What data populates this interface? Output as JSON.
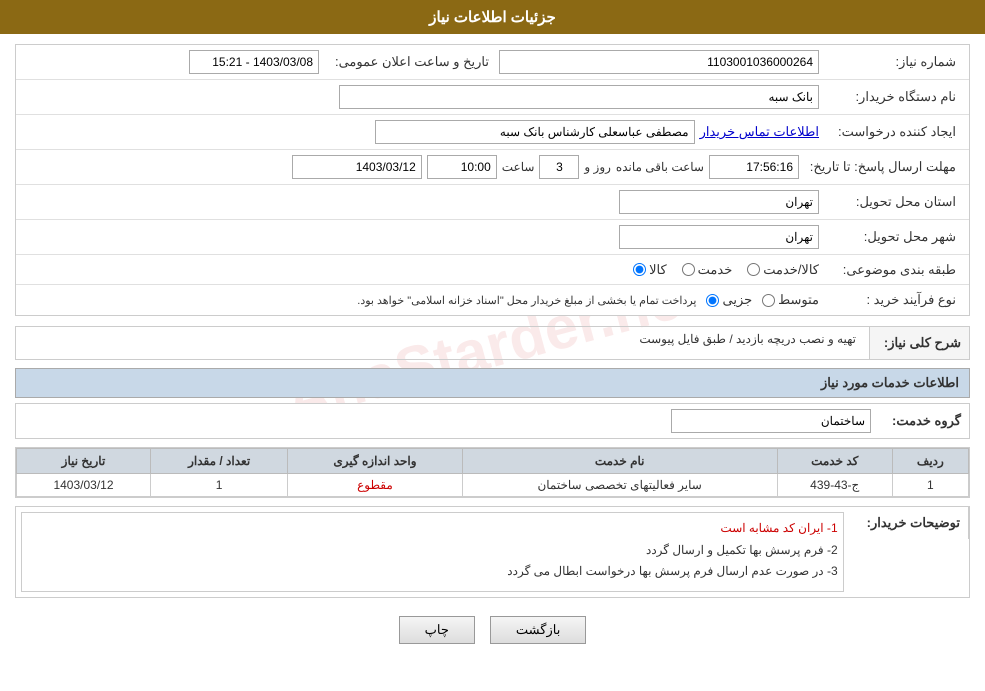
{
  "page": {
    "title": "جزئیات اطلاعات نیاز",
    "header": {
      "label": "جزئیات اطلاعات نیاز"
    }
  },
  "form": {
    "need_number_label": "شماره نیاز:",
    "need_number_value": "1103001036000264",
    "buyer_org_label": "نام دستگاه خریدار:",
    "buyer_org_value": "بانک سبه",
    "requester_label": "ایجاد کننده درخواست:",
    "requester_value": "مصطفی عباسعلی کارشناس بانک سبه",
    "requester_link": "اطلاعات تماس خریدار",
    "announce_date_label": "تاریخ و ساعت اعلان عمومی:",
    "announce_date_value": "1403/03/08 - 15:21",
    "deadline_label": "مهلت ارسال پاسخ: تا تاریخ:",
    "deadline_date": "1403/03/12",
    "deadline_time": "10:00",
    "deadline_days": "3",
    "deadline_clock": "17:56:16",
    "deadline_remaining": "ساعت باقی مانده",
    "deadline_day_label": "روز و",
    "deadline_time_label": "ساعت",
    "province_label": "استان محل تحویل:",
    "province_value": "تهران",
    "city_label": "شهر محل تحویل:",
    "city_value": "تهران",
    "category_label": "طبقه بندی موضوعی:",
    "category_options": [
      {
        "label": "کالا",
        "value": "kala"
      },
      {
        "label": "خدمت",
        "value": "khedmat"
      },
      {
        "label": "کالا/خدمت",
        "value": "kala_khedmat"
      }
    ],
    "purchase_type_label": "نوع فرآیند خرید :",
    "purchase_type_options": [
      {
        "label": "جزیی",
        "value": "jozi"
      },
      {
        "label": "متوسط",
        "value": "motavaset"
      }
    ],
    "purchase_type_note": "پرداخت تمام یا بخشی از مبلغ خریدار محل \"اسناد خزانه اسلامی\" خواهد بود.",
    "needs_description_label": "شرح کلی نیاز:",
    "needs_description_value": "تهیه و نصب دریچه بازدید / طبق فایل پیوست",
    "services_section_title": "اطلاعات خدمات مورد نیاز",
    "service_group_label": "گروه خدمت:",
    "service_group_value": "ساختمان",
    "table": {
      "columns": [
        {
          "key": "row",
          "label": "ردیف"
        },
        {
          "key": "code",
          "label": "کد خدمت"
        },
        {
          "key": "name",
          "label": "نام خدمت"
        },
        {
          "key": "unit",
          "label": "واحد اندازه گیری"
        },
        {
          "key": "count",
          "label": "تعداد / مقدار"
        },
        {
          "key": "date",
          "label": "تاریخ نیاز"
        }
      ],
      "rows": [
        {
          "row": "1",
          "code": "ج-43-439",
          "name": "سایر فعالیتهای تخصصی ساختمان",
          "unit": "مقطوع",
          "count": "1",
          "date": "1403/03/12"
        }
      ]
    },
    "buyer_desc_label": "توضیحات خریدار:",
    "buyer_desc_lines": [
      {
        "text": "1- ایران کد مشابه است",
        "color": "red"
      },
      {
        "text": "2- فرم پرسش بها تکمیل و ارسال گردد",
        "color": "normal"
      },
      {
        "text": "3- در صورت عدم ارسال فرم پرسش بها درخواست ابطال می گردد",
        "color": "normal"
      }
    ],
    "buttons": {
      "print": "چاپ",
      "back": "بازگشت"
    }
  }
}
